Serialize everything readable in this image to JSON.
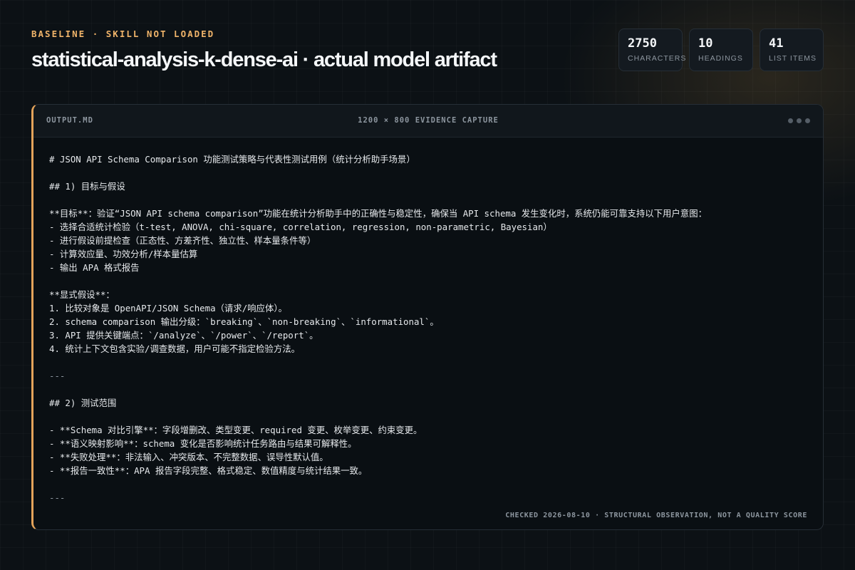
{
  "header": {
    "eyebrow": "BASELINE · SKILL NOT LOADED",
    "title": "statistical-analysis-k-dense-ai · actual model artifact"
  },
  "stats": [
    {
      "value": "2750",
      "label": "CHARACTERS"
    },
    {
      "value": "10",
      "label": "HEADINGS"
    },
    {
      "value": "41",
      "label": "LIST ITEMS"
    }
  ],
  "panel": {
    "filename": "OUTPUT.MD",
    "caption": "1200 × 800 EVIDENCE CAPTURE",
    "footer": "CHECKED 2026-08-10 · STRUCTURAL OBSERVATION, NOT A QUALITY SCORE",
    "lines": [
      "# JSON API Schema Comparison 功能测试策略与代表性测试用例（统计分析助手场景）",
      "",
      "## 1) 目标与假设",
      "",
      "**目标**：验证“JSON API schema comparison”功能在统计分析助手中的正确性与稳定性，确保当 API schema 发生变化时，系统仍能可靠支持以下用户意图：",
      "- 选择合适统计检验（t-test, ANOVA, chi-square, correlation, regression, non-parametric, Bayesian）",
      "- 进行假设前提检查（正态性、方差齐性、独立性、样本量条件等）",
      "- 计算效应量、功效分析/样本量估算",
      "- 输出 APA 格式报告",
      "",
      "**显式假设**：",
      "1. 比较对象是 OpenAPI/JSON Schema（请求/响应体）。",
      "2. schema comparison 输出分级：`breaking`、`non-breaking`、`informational`。",
      "3. API 提供关键端点：`/analyze`、`/power`、`/report`。",
      "4. 统计上下文包含实验/调查数据，用户可能不指定检验方法。",
      "",
      "---",
      "",
      "## 2) 测试范围",
      "",
      "- **Schema 对比引擎**：字段增删改、类型变更、required 变更、枚举变更、约束变更。",
      "- **语义映射影响**：schema 变化是否影响统计任务路由与结果可解释性。",
      "- **失败处理**：非法输入、冲突版本、不完整数据、误导性默认值。",
      "- **报告一致性**：APA 报告字段完整、格式稳定、数值精度与统计结果一致。",
      "",
      "---"
    ]
  },
  "colors": {
    "accent": "#e3a35a",
    "eyebrow": "#f0b46a",
    "background": "#0c1115",
    "panel": "#0a0f13",
    "muted_text": "#8d969f"
  }
}
